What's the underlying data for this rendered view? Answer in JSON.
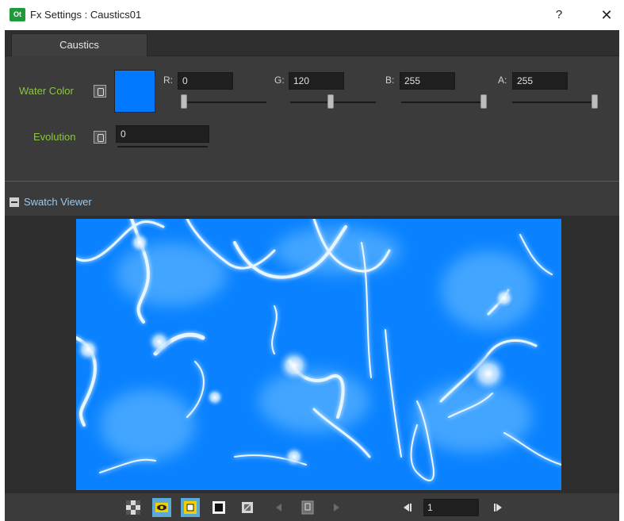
{
  "window": {
    "icon_text": "Ot",
    "title": "Fx Settings : Caustics01",
    "help_label": "?",
    "close_label": "✕"
  },
  "tabs": [
    {
      "label": "Caustics",
      "selected": true
    }
  ],
  "params": {
    "water_color": {
      "label": "Water Color",
      "swatch_color": "#0078ff",
      "channels": [
        {
          "label": "R:",
          "value": "0",
          "fraction": 0.0
        },
        {
          "label": "G:",
          "value": "120",
          "fraction": 0.47
        },
        {
          "label": "B:",
          "value": "255",
          "fraction": 1.0
        },
        {
          "label": "A:",
          "value": "255",
          "fraction": 1.0
        }
      ]
    },
    "evolution": {
      "label": "Evolution",
      "value": "0"
    }
  },
  "viewer": {
    "title": "Swatch Viewer",
    "collapse_label": "−"
  },
  "toolbar": {
    "frame_value": "1",
    "prev_frame_symbol": "◀I",
    "next_frame_symbol": "I▶",
    "buttons": [
      {
        "name": "checkerboard-bg-button",
        "active": false
      },
      {
        "name": "preview-eye-button",
        "active": true
      },
      {
        "name": "white-bg-button",
        "active": true
      },
      {
        "name": "black-bg-button",
        "active": false
      },
      {
        "name": "camera-view-button",
        "active": false
      },
      {
        "name": "prev-key-button",
        "active": false
      },
      {
        "name": "set-key-button",
        "active": false
      },
      {
        "name": "next-key-button",
        "active": false
      }
    ]
  },
  "colors": {
    "panel_bg": "#3b3b3b",
    "label_green": "#8cc63f",
    "viewer_title_blue": "#9ec8ea",
    "water_blue": "#0a82ff",
    "active_button": "#5aa9d6"
  }
}
